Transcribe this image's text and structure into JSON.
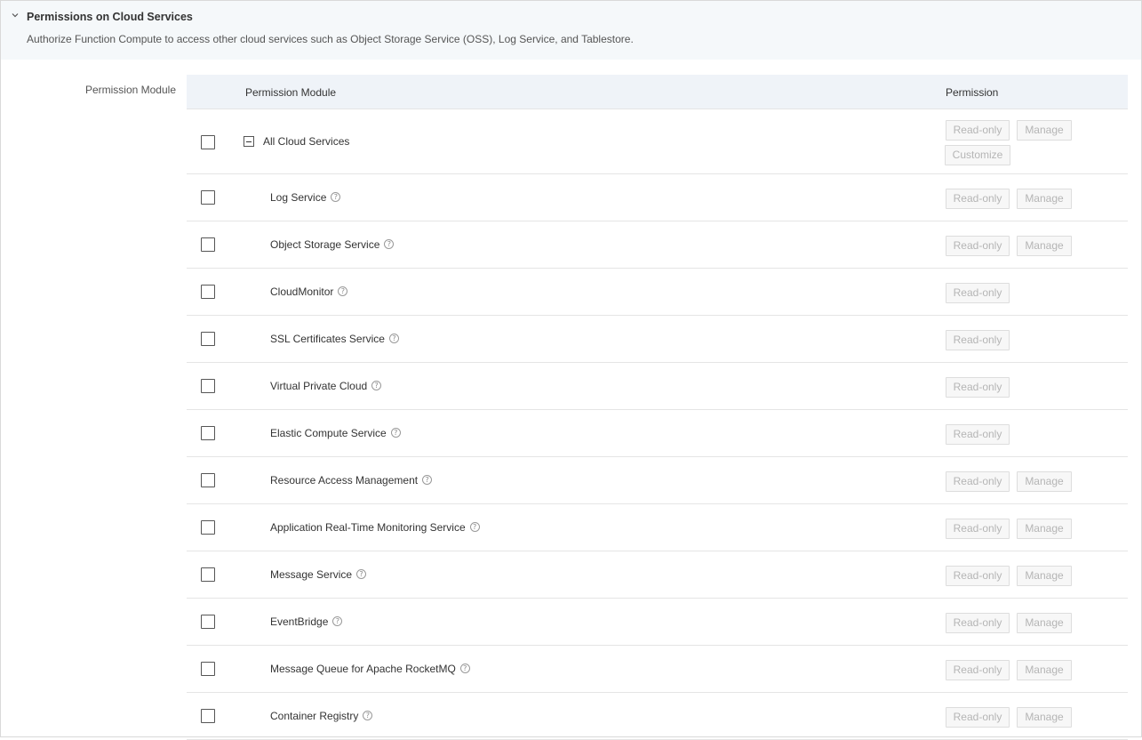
{
  "section": {
    "title": "Permissions on Cloud Services",
    "description": "Authorize Function Compute to access other cloud services such as Object Storage Service (OSS), Log Service, and Tablestore.",
    "icon": "chevron-down-icon"
  },
  "field_label": "Permission Module",
  "table": {
    "headers": {
      "module": "Permission Module",
      "permission": "Permission"
    },
    "all_row": {
      "label": "All Cloud Services",
      "buttons": {
        "read_only": "Read-only",
        "manage": "Manage",
        "customize": "Customize"
      }
    },
    "rows": [
      {
        "name": "Log Service",
        "read_only": "Read-only",
        "manage": "Manage"
      },
      {
        "name": "Object Storage Service",
        "read_only": "Read-only",
        "manage": "Manage"
      },
      {
        "name": "CloudMonitor",
        "read_only": "Read-only"
      },
      {
        "name": "SSL Certificates Service",
        "read_only": "Read-only"
      },
      {
        "name": "Virtual Private Cloud",
        "read_only": "Read-only"
      },
      {
        "name": "Elastic Compute Service",
        "read_only": "Read-only"
      },
      {
        "name": "Resource Access Management",
        "read_only": "Read-only",
        "manage": "Manage"
      },
      {
        "name": "Application Real-Time Monitoring Service",
        "read_only": "Read-only",
        "manage": "Manage"
      },
      {
        "name": "Message Service",
        "read_only": "Read-only",
        "manage": "Manage"
      },
      {
        "name": "EventBridge",
        "read_only": "Read-only",
        "manage": "Manage"
      },
      {
        "name": "Message Queue for Apache RocketMQ",
        "read_only": "Read-only",
        "manage": "Manage"
      },
      {
        "name": "Container Registry",
        "read_only": "Read-only",
        "manage": "Manage"
      }
    ]
  },
  "colors": {
    "header_bg": "#f5f8fa",
    "table_header_bg": "#eff3f8",
    "disabled_text": "#b5b5b5"
  }
}
